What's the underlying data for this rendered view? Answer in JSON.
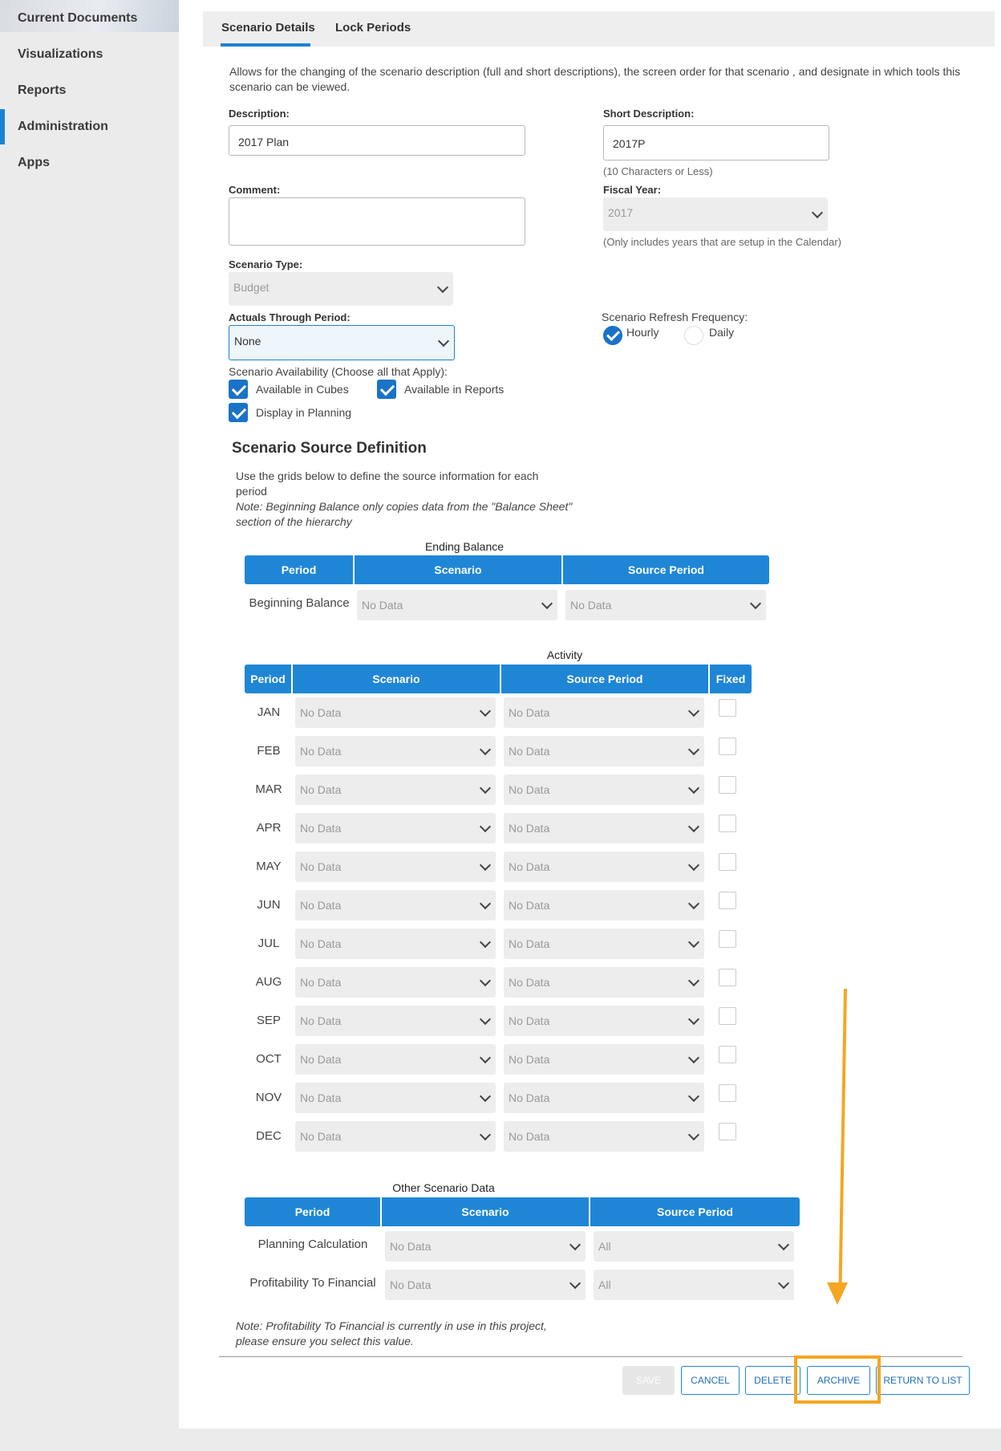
{
  "sidebar": {
    "items": [
      {
        "label": "Current Documents"
      },
      {
        "label": "Visualizations"
      },
      {
        "label": "Reports"
      },
      {
        "label": "Administration"
      },
      {
        "label": "Apps"
      }
    ],
    "active": "Administration"
  },
  "tabs": [
    {
      "label": "Scenario Details",
      "active": true
    },
    {
      "label": "Lock Periods",
      "active": false
    }
  ],
  "intro": "Allows for the changing of the scenario description (full and short descriptions), the screen order for that scenario , and designate in which tools this scenario can be viewed.",
  "form": {
    "description_label": "Description:",
    "description_value": "2017 Plan",
    "short_description_label": "Short Description:",
    "short_description_value": "2017P",
    "short_description_hint": "(10 Characters or Less)",
    "comment_label": "Comment:",
    "comment_value": "",
    "fiscal_year_label": "Fiscal Year:",
    "fiscal_year_value": "2017",
    "fiscal_year_hint": "(Only includes years that are setup in the Calendar)",
    "scenario_type_label": "Scenario Type:",
    "scenario_type_value": "Budget",
    "actuals_label": "Actuals Through Period:",
    "actuals_value": "None",
    "refresh_label": "Scenario Refresh Frequency:",
    "refresh_options": [
      {
        "label": "Hourly",
        "selected": true
      },
      {
        "label": "Daily",
        "selected": false
      }
    ],
    "availability_label": "Scenario Availability (Choose all that Apply):",
    "availability": [
      {
        "label": "Available in Cubes",
        "checked": true
      },
      {
        "label": "Available in Reports",
        "checked": true
      },
      {
        "label": "Display in Planning",
        "checked": true
      }
    ]
  },
  "source": {
    "title": "Scenario Source Definition",
    "desc": "Use the grids below to define the source information for each period",
    "note": "Note: Beginning Balance only copies data from the \"Balance Sheet\" section of the hierarchy",
    "ending_balance": {
      "title": "Ending Balance",
      "headers": [
        "Period",
        "Scenario",
        "Source Period"
      ],
      "rows": [
        {
          "label": "Beginning Balance",
          "scenario": "No Data",
          "source_period": "No Data"
        }
      ]
    },
    "activity": {
      "title": "Activity",
      "headers": [
        "Period",
        "Scenario",
        "Source Period",
        "Fixed"
      ],
      "rows": [
        {
          "period": "JAN",
          "scenario": "No Data",
          "source_period": "No Data",
          "fixed": false
        },
        {
          "period": "FEB",
          "scenario": "No Data",
          "source_period": "No Data",
          "fixed": false
        },
        {
          "period": "MAR",
          "scenario": "No Data",
          "source_period": "No Data",
          "fixed": false
        },
        {
          "period": "APR",
          "scenario": "No Data",
          "source_period": "No Data",
          "fixed": false
        },
        {
          "period": "MAY",
          "scenario": "No Data",
          "source_period": "No Data",
          "fixed": false
        },
        {
          "period": "JUN",
          "scenario": "No Data",
          "source_period": "No Data",
          "fixed": false
        },
        {
          "period": "JUL",
          "scenario": "No Data",
          "source_period": "No Data",
          "fixed": false
        },
        {
          "period": "AUG",
          "scenario": "No Data",
          "source_period": "No Data",
          "fixed": false
        },
        {
          "period": "SEP",
          "scenario": "No Data",
          "source_period": "No Data",
          "fixed": false
        },
        {
          "period": "OCT",
          "scenario": "No Data",
          "source_period": "No Data",
          "fixed": false
        },
        {
          "period": "NOV",
          "scenario": "No Data",
          "source_period": "No Data",
          "fixed": false
        },
        {
          "period": "DEC",
          "scenario": "No Data",
          "source_period": "No Data",
          "fixed": false
        }
      ]
    },
    "other": {
      "title": "Other Scenario Data",
      "headers": [
        "Period",
        "Scenario",
        "Source Period"
      ],
      "rows": [
        {
          "label": "Planning Calculation",
          "scenario": "No Data",
          "source_period": "All"
        },
        {
          "label": "Profitability To Financial",
          "scenario": "No Data",
          "source_period": "All"
        }
      ]
    },
    "footer_note": "Note: Profitability To Financial is currently in use in this project, please ensure you select this value."
  },
  "buttons": {
    "save": "SAVE",
    "cancel": "CANCEL",
    "delete": "DELETE",
    "archive": "ARCHIVE",
    "return": "RETURN TO LIST"
  },
  "colors": {
    "accent": "#1f86d6",
    "highlight": "#f5a623"
  }
}
